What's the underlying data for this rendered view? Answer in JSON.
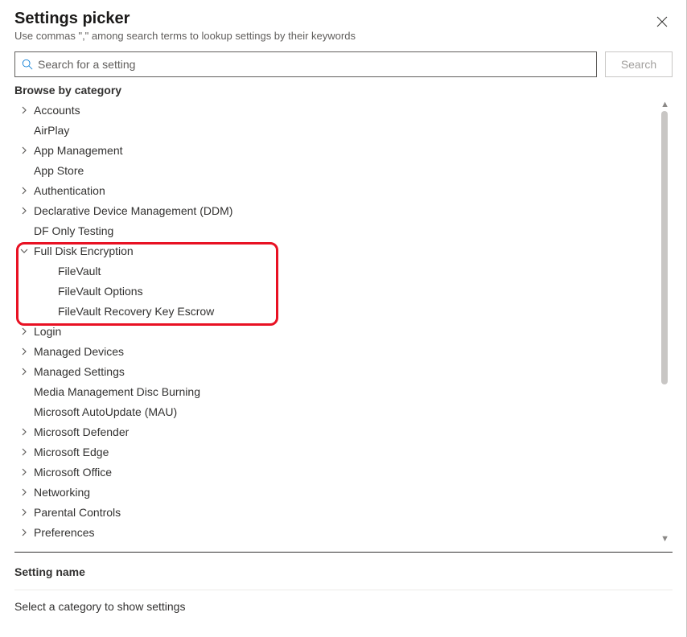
{
  "header": {
    "title": "Settings picker",
    "subtitle": "Use commas \",\" among search terms to lookup settings by their keywords"
  },
  "search": {
    "placeholder": "Search for a setting",
    "value": "",
    "button_label": "Search"
  },
  "browse_label": "Browse by category",
  "categories": [
    {
      "label": "Accounts",
      "expandable": true,
      "expanded": false,
      "level": 0
    },
    {
      "label": "AirPlay",
      "expandable": false,
      "level": 0
    },
    {
      "label": "App Management",
      "expandable": true,
      "expanded": false,
      "level": 0
    },
    {
      "label": "App Store",
      "expandable": false,
      "level": 0
    },
    {
      "label": "Authentication",
      "expandable": true,
      "expanded": false,
      "level": 0
    },
    {
      "label": "Declarative Device Management (DDM)",
      "expandable": true,
      "expanded": false,
      "level": 0
    },
    {
      "label": "DF Only Testing",
      "expandable": false,
      "level": 0
    },
    {
      "label": "Full Disk Encryption",
      "expandable": true,
      "expanded": true,
      "level": 0,
      "highlighted": true
    },
    {
      "label": "FileVault",
      "expandable": false,
      "level": 1,
      "highlighted": true
    },
    {
      "label": "FileVault Options",
      "expandable": false,
      "level": 1,
      "highlighted": true
    },
    {
      "label": "FileVault Recovery Key Escrow",
      "expandable": false,
      "level": 1,
      "highlighted": true
    },
    {
      "label": "Login",
      "expandable": true,
      "expanded": false,
      "level": 0
    },
    {
      "label": "Managed Devices",
      "expandable": true,
      "expanded": false,
      "level": 0
    },
    {
      "label": "Managed Settings",
      "expandable": true,
      "expanded": false,
      "level": 0
    },
    {
      "label": "Media Management Disc Burning",
      "expandable": false,
      "level": 0
    },
    {
      "label": "Microsoft AutoUpdate (MAU)",
      "expandable": false,
      "level": 0
    },
    {
      "label": "Microsoft Defender",
      "expandable": true,
      "expanded": false,
      "level": 0
    },
    {
      "label": "Microsoft Edge",
      "expandable": true,
      "expanded": false,
      "level": 0
    },
    {
      "label": "Microsoft Office",
      "expandable": true,
      "expanded": false,
      "level": 0
    },
    {
      "label": "Networking",
      "expandable": true,
      "expanded": false,
      "level": 0
    },
    {
      "label": "Parental Controls",
      "expandable": true,
      "expanded": false,
      "level": 0
    },
    {
      "label": "Preferences",
      "expandable": true,
      "expanded": false,
      "level": 0
    }
  ],
  "settings_panel": {
    "header": "Setting name",
    "empty_message": "Select a category to show settings"
  },
  "highlight_color": "#e81123"
}
